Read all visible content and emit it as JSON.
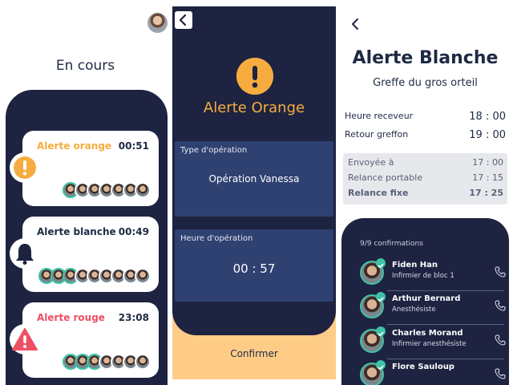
{
  "panel1": {
    "title": "En cours",
    "alerts": [
      {
        "name": "Alerte orange",
        "time": "00:51",
        "color": "#f7ac3f",
        "icon": "warning-circle-icon"
      },
      {
        "name": "Alerte blanche",
        "time": "00:49",
        "color": "#1d2340",
        "icon": "bell-icon"
      },
      {
        "name": "Alerte rouge",
        "time": "23:08",
        "color": "#ee4f63",
        "icon": "warning-triangle-icon"
      }
    ]
  },
  "panel2": {
    "title": "Alerte Orange",
    "operation_type_label": "Type d'opération",
    "operation_type_value": "Opération Vanessa",
    "operation_time_label": "Heure d'opération",
    "operation_time_value": "00 : 57",
    "confirm_label": "Confirmer"
  },
  "panel3": {
    "title": "Alerte Blanche",
    "subtitle": "Greffe du gros orteil",
    "rows": [
      {
        "label": "Heure receveur",
        "value": "18 : 00"
      },
      {
        "label": "Retour greffon",
        "value": "19 : 00"
      }
    ],
    "status_rows": [
      {
        "label": "Envoyée à",
        "value": "17 : 00"
      },
      {
        "label": "Relance portable",
        "value": "17 : 15"
      },
      {
        "label": "Relance fixe",
        "value": "17 : 25"
      }
    ],
    "confirmations": "9/9 confirmations",
    "people": [
      {
        "name": "Fiden Han",
        "role": "Infirmier de bloc 1"
      },
      {
        "name": "Arthur Bernard",
        "role": "Anesthésiste"
      },
      {
        "name": "Charles Morand",
        "role": "Infirmier anesthésiste"
      },
      {
        "name": "Flore Sauloup",
        "role": ""
      }
    ]
  },
  "colors": {
    "navy": "#1d2340",
    "orange": "#f7ac3f",
    "red": "#ee4f63",
    "teal": "#3fc2a5",
    "box": "#2f4170",
    "peach": "#ffcc88"
  }
}
